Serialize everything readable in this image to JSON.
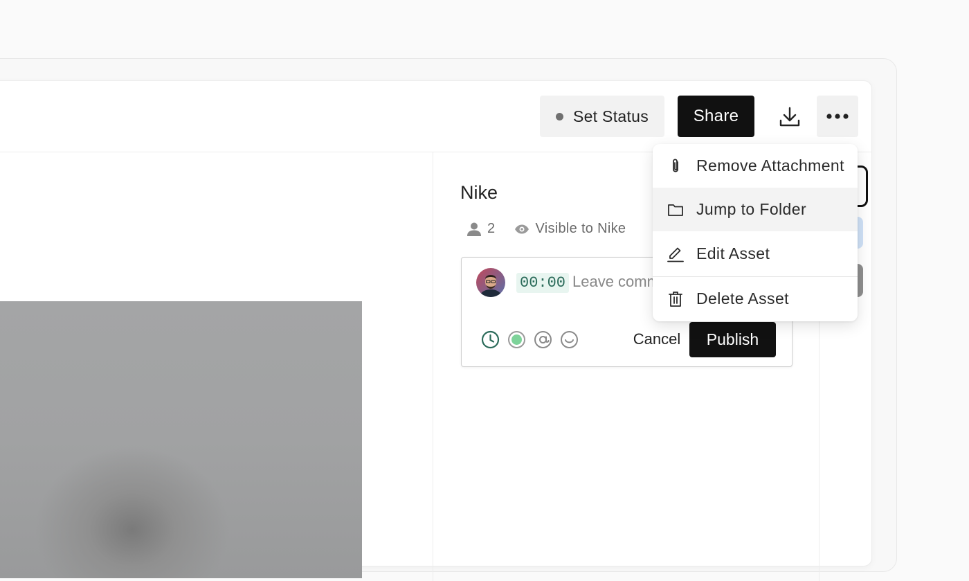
{
  "toolbar": {
    "set_status_label": "Set Status",
    "share_label": "Share"
  },
  "asset": {
    "title": "Nike",
    "viewer_count": "2",
    "visibility": "Visible to Nike"
  },
  "comment": {
    "timecode": "00:00",
    "placeholder": "Leave comment",
    "cancel_label": "Cancel",
    "publish_label": "Publish"
  },
  "menu": {
    "items": [
      {
        "label": "Remove Attachment",
        "icon": "paperclip-icon"
      },
      {
        "label": "Jump to Folder",
        "icon": "folder-icon"
      },
      {
        "label": "Edit Asset",
        "icon": "pencil-icon"
      },
      {
        "label": "Delete Asset",
        "icon": "trash-icon"
      }
    ]
  },
  "colors": {
    "primary_button": "#111111",
    "timecode_bg": "#e8f5f0",
    "timecode_text": "#2b6b5a",
    "status_dot": "#707070",
    "green_dot": "#7ed39a"
  }
}
